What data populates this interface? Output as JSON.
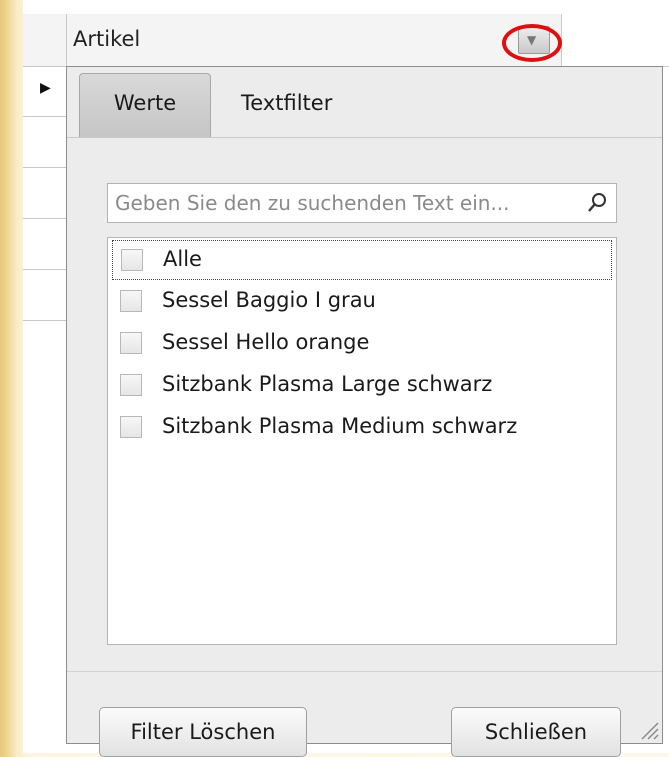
{
  "grid": {
    "column_header": "Artikel"
  },
  "popup": {
    "tabs": [
      {
        "label": "Werte",
        "active": true
      },
      {
        "label": "Textfilter",
        "active": false
      }
    ],
    "search": {
      "placeholder": "Geben Sie den zu suchenden Text ein..."
    },
    "items": [
      {
        "label": "Alle",
        "checked": false
      },
      {
        "label": "Sessel Baggio I grau",
        "checked": false
      },
      {
        "label": "Sessel Hello orange",
        "checked": false
      },
      {
        "label": "Sitzbank Plasma Large schwarz",
        "checked": false
      },
      {
        "label": "Sitzbank Plasma Medium schwarz",
        "checked": false
      }
    ],
    "buttons": {
      "clear": "Filter Löschen",
      "close": "Schließen"
    }
  },
  "colors": {
    "highlight_circle": "#e00f0f",
    "active_tab": "#cfcfcf"
  }
}
